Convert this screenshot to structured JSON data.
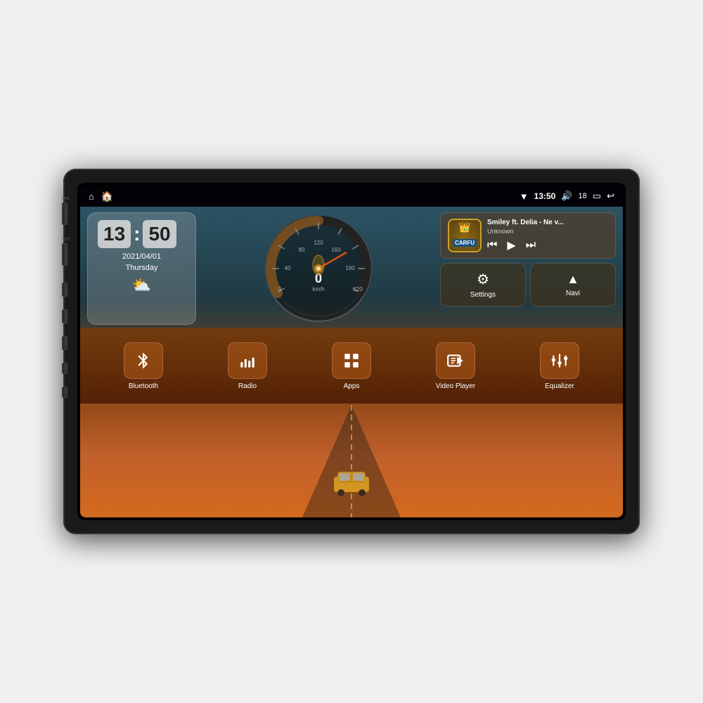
{
  "device": {
    "side_labels": [
      "MIC",
      "RST"
    ]
  },
  "status_bar": {
    "home_icon": "⌂",
    "house_icon": "🏠",
    "wifi_icon": "▼",
    "time": "13:50",
    "volume_icon": "🔊",
    "volume_level": "18",
    "battery_icon": "🔋",
    "back_icon": "↩"
  },
  "clock_widget": {
    "hour": "13",
    "minute": "50",
    "date": "2021/04/01",
    "day": "Thursday",
    "weather_icon": "⛅"
  },
  "music_widget": {
    "title": "Smiley ft. Delia - Ne v...",
    "artist": "Unknown",
    "crown_icon": "👑",
    "logo_text": "CARFU",
    "prev_icon": "⏮",
    "play_icon": "▶",
    "next_icon": "⏭"
  },
  "action_buttons": [
    {
      "id": "settings",
      "label": "Settings",
      "icon": "⚙"
    },
    {
      "id": "navi",
      "label": "Navi",
      "icon": "⬆"
    }
  ],
  "app_bar": {
    "items": [
      {
        "id": "bluetooth",
        "label": "Bluetooth",
        "icon": "bluetooth"
      },
      {
        "id": "radio",
        "label": "Radio",
        "icon": "radio"
      },
      {
        "id": "apps",
        "label": "Apps",
        "icon": "apps"
      },
      {
        "id": "video_player",
        "label": "Video Player",
        "icon": "video"
      },
      {
        "id": "equalizer",
        "label": "Equalizer",
        "icon": "equalizer"
      }
    ]
  },
  "speedometer": {
    "speed_value": "0",
    "speed_unit": "km/h"
  }
}
